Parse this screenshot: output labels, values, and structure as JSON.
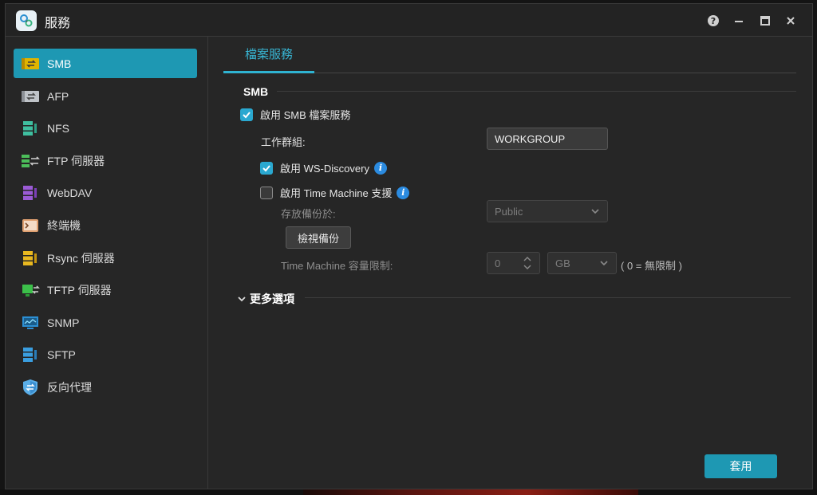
{
  "window": {
    "title": "服務",
    "controls": [
      "help-icon",
      "minimize-icon",
      "maximize-icon",
      "close-icon"
    ]
  },
  "sidebar": {
    "items": [
      {
        "label": "SMB",
        "icon": "smb-icon",
        "active": true
      },
      {
        "label": "AFP",
        "icon": "afp-icon",
        "active": false
      },
      {
        "label": "NFS",
        "icon": "nfs-icon",
        "active": false
      },
      {
        "label": "FTP 伺服器",
        "icon": "ftp-icon",
        "active": false
      },
      {
        "label": "WebDAV",
        "icon": "webdav-icon",
        "active": false
      },
      {
        "label": "終端機",
        "icon": "terminal-icon",
        "active": false
      },
      {
        "label": "Rsync 伺服器",
        "icon": "rsync-icon",
        "active": false
      },
      {
        "label": "TFTP 伺服器",
        "icon": "tftp-icon",
        "active": false
      },
      {
        "label": "SNMP",
        "icon": "snmp-icon",
        "active": false
      },
      {
        "label": "SFTP",
        "icon": "sftp-icon",
        "active": false
      },
      {
        "label": "反向代理",
        "icon": "reverse-proxy-icon",
        "active": false
      }
    ]
  },
  "main": {
    "tabs": [
      {
        "label": "檔案服務",
        "active": true
      }
    ],
    "section_title": "SMB",
    "enable_smb": {
      "label": "啟用 SMB 檔案服務",
      "checked": true
    },
    "workgroup": {
      "label": "工作群組:",
      "value": "WORKGROUP"
    },
    "ws_discovery": {
      "label": "啟用 WS-Discovery",
      "checked": true
    },
    "time_machine": {
      "label": "啟用 Time Machine 支援",
      "checked": false
    },
    "backup_location": {
      "label": "存放備份於:",
      "value": "Public"
    },
    "view_backup_label": "檢視備份",
    "capacity": {
      "label": "Time Machine 容量限制:",
      "value": "0",
      "unit": "GB",
      "hint": "( 0 = 無限制 )"
    },
    "more_options": "更多選項",
    "apply_label": "套用"
  },
  "colors": {
    "accent": "#1e98b3",
    "tab_text": "#38b6d4",
    "checkbox": "#2aa8d0",
    "info": "#2b8be0"
  }
}
